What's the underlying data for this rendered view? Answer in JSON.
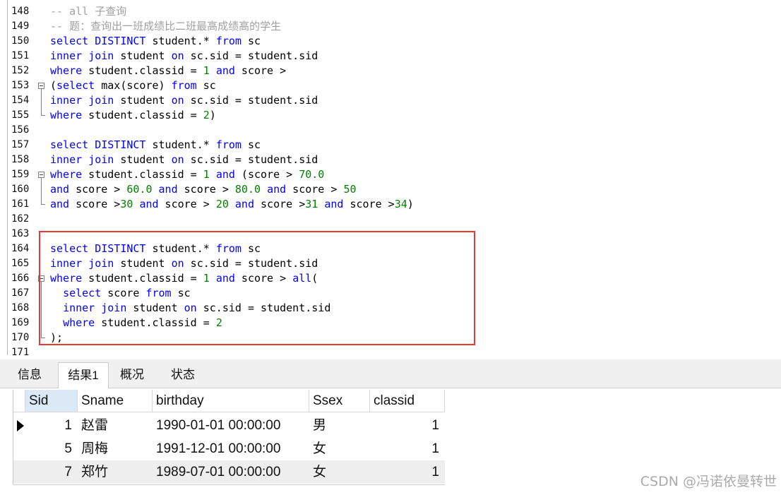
{
  "editor": {
    "lines": [
      {
        "num": "148",
        "tokens": [
          {
            "t": "-- all 子查询",
            "c": "cm"
          }
        ]
      },
      {
        "num": "149",
        "tokens": [
          {
            "t": "-- 题：查询出一班成绩比二班最高成绩高的学生",
            "c": "cm"
          }
        ]
      },
      {
        "num": "150",
        "tokens": [
          {
            "t": "select",
            "c": "kw"
          },
          {
            "t": " ",
            "c": "id"
          },
          {
            "t": "DISTINCT",
            "c": "kw"
          },
          {
            "t": " student.* ",
            "c": "id"
          },
          {
            "t": "from",
            "c": "kw"
          },
          {
            "t": " sc",
            "c": "id"
          }
        ]
      },
      {
        "num": "151",
        "tokens": [
          {
            "t": "inner",
            "c": "kw"
          },
          {
            "t": " ",
            "c": "id"
          },
          {
            "t": "join",
            "c": "kw"
          },
          {
            "t": " student ",
            "c": "id"
          },
          {
            "t": "on",
            "c": "kw"
          },
          {
            "t": " sc.sid = student.sid",
            "c": "id"
          }
        ]
      },
      {
        "num": "152",
        "tokens": [
          {
            "t": "where",
            "c": "kw"
          },
          {
            "t": " student.classid = ",
            "c": "id"
          },
          {
            "t": "1",
            "c": "num"
          },
          {
            "t": " ",
            "c": "id"
          },
          {
            "t": "and",
            "c": "kw"
          },
          {
            "t": " score >",
            "c": "id"
          }
        ]
      },
      {
        "num": "153",
        "tokens": [
          {
            "t": "(",
            "c": "id"
          },
          {
            "t": "select",
            "c": "kw"
          },
          {
            "t": " max(score) ",
            "c": "id"
          },
          {
            "t": "from",
            "c": "kw"
          },
          {
            "t": " sc",
            "c": "id"
          }
        ]
      },
      {
        "num": "154",
        "tokens": [
          {
            "t": "inner",
            "c": "kw"
          },
          {
            "t": " ",
            "c": "id"
          },
          {
            "t": "join",
            "c": "kw"
          },
          {
            "t": " student ",
            "c": "id"
          },
          {
            "t": "on",
            "c": "kw"
          },
          {
            "t": " sc.sid = student.sid",
            "c": "id"
          }
        ]
      },
      {
        "num": "155",
        "tokens": [
          {
            "t": "where",
            "c": "kw"
          },
          {
            "t": " student.classid = ",
            "c": "id"
          },
          {
            "t": "2",
            "c": "num"
          },
          {
            "t": ")",
            "c": "id"
          }
        ]
      },
      {
        "num": "156",
        "tokens": []
      },
      {
        "num": "157",
        "tokens": [
          {
            "t": "select",
            "c": "kw"
          },
          {
            "t": " ",
            "c": "id"
          },
          {
            "t": "DISTINCT",
            "c": "kw"
          },
          {
            "t": " student.* ",
            "c": "id"
          },
          {
            "t": "from",
            "c": "kw"
          },
          {
            "t": " sc",
            "c": "id"
          }
        ]
      },
      {
        "num": "158",
        "tokens": [
          {
            "t": "inner",
            "c": "kw"
          },
          {
            "t": " ",
            "c": "id"
          },
          {
            "t": "join",
            "c": "kw"
          },
          {
            "t": " student ",
            "c": "id"
          },
          {
            "t": "on",
            "c": "kw"
          },
          {
            "t": " sc.sid = student.sid",
            "c": "id"
          }
        ]
      },
      {
        "num": "159",
        "tokens": [
          {
            "t": "where",
            "c": "kw"
          },
          {
            "t": " student.classid = ",
            "c": "id"
          },
          {
            "t": "1",
            "c": "num"
          },
          {
            "t": " ",
            "c": "id"
          },
          {
            "t": "and",
            "c": "kw"
          },
          {
            "t": " (score > ",
            "c": "id"
          },
          {
            "t": "70.0",
            "c": "num"
          }
        ]
      },
      {
        "num": "160",
        "tokens": [
          {
            "t": "and",
            "c": "kw"
          },
          {
            "t": " score > ",
            "c": "id"
          },
          {
            "t": "60.0",
            "c": "num"
          },
          {
            "t": " ",
            "c": "id"
          },
          {
            "t": "and",
            "c": "kw"
          },
          {
            "t": " score > ",
            "c": "id"
          },
          {
            "t": "80.0",
            "c": "num"
          },
          {
            "t": " ",
            "c": "id"
          },
          {
            "t": "and",
            "c": "kw"
          },
          {
            "t": " score > ",
            "c": "id"
          },
          {
            "t": "50",
            "c": "num"
          }
        ]
      },
      {
        "num": "161",
        "tokens": [
          {
            "t": "and",
            "c": "kw"
          },
          {
            "t": " score >",
            "c": "id"
          },
          {
            "t": "30",
            "c": "num"
          },
          {
            "t": " ",
            "c": "id"
          },
          {
            "t": "and",
            "c": "kw"
          },
          {
            "t": " score > ",
            "c": "id"
          },
          {
            "t": "20",
            "c": "num"
          },
          {
            "t": " ",
            "c": "id"
          },
          {
            "t": "and",
            "c": "kw"
          },
          {
            "t": " score >",
            "c": "id"
          },
          {
            "t": "31",
            "c": "num"
          },
          {
            "t": " ",
            "c": "id"
          },
          {
            "t": "and",
            "c": "kw"
          },
          {
            "t": " score >",
            "c": "id"
          },
          {
            "t": "34",
            "c": "num"
          },
          {
            "t": ")",
            "c": "id"
          }
        ]
      },
      {
        "num": "162",
        "tokens": []
      },
      {
        "num": "163",
        "tokens": []
      },
      {
        "num": "164",
        "tokens": [
          {
            "t": "select",
            "c": "kw"
          },
          {
            "t": " ",
            "c": "id"
          },
          {
            "t": "DISTINCT",
            "c": "kw"
          },
          {
            "t": " student.* ",
            "c": "id"
          },
          {
            "t": "from",
            "c": "kw"
          },
          {
            "t": " sc",
            "c": "id"
          }
        ]
      },
      {
        "num": "165",
        "tokens": [
          {
            "t": "inner",
            "c": "kw"
          },
          {
            "t": " ",
            "c": "id"
          },
          {
            "t": "join",
            "c": "kw"
          },
          {
            "t": " student ",
            "c": "id"
          },
          {
            "t": "on",
            "c": "kw"
          },
          {
            "t": " sc.sid = student.sid",
            "c": "id"
          }
        ]
      },
      {
        "num": "166",
        "tokens": [
          {
            "t": "where",
            "c": "kw"
          },
          {
            "t": " student.classid = ",
            "c": "id"
          },
          {
            "t": "1",
            "c": "num"
          },
          {
            "t": " ",
            "c": "id"
          },
          {
            "t": "and",
            "c": "kw"
          },
          {
            "t": " score > ",
            "c": "id"
          },
          {
            "t": "all",
            "c": "kw"
          },
          {
            "t": "(",
            "c": "id"
          }
        ]
      },
      {
        "num": "167",
        "tokens": [
          {
            "t": "  ",
            "c": "id"
          },
          {
            "t": "select",
            "c": "kw"
          },
          {
            "t": " score ",
            "c": "id"
          },
          {
            "t": "from",
            "c": "kw"
          },
          {
            "t": " sc",
            "c": "id"
          }
        ]
      },
      {
        "num": "168",
        "tokens": [
          {
            "t": "  ",
            "c": "id"
          },
          {
            "t": "inner",
            "c": "kw"
          },
          {
            "t": " ",
            "c": "id"
          },
          {
            "t": "join",
            "c": "kw"
          },
          {
            "t": " student ",
            "c": "id"
          },
          {
            "t": "on",
            "c": "kw"
          },
          {
            "t": " sc.sid = student.sid",
            "c": "id"
          }
        ]
      },
      {
        "num": "169",
        "tokens": [
          {
            "t": "  ",
            "c": "id"
          },
          {
            "t": "where",
            "c": "kw"
          },
          {
            "t": " student.classid = ",
            "c": "id"
          },
          {
            "t": "2",
            "c": "num"
          }
        ]
      },
      {
        "num": "170",
        "tokens": [
          {
            "t": ");",
            "c": "id"
          }
        ]
      },
      {
        "num": "171",
        "tokens": []
      }
    ]
  },
  "tabs": [
    {
      "label": "信息",
      "active": false
    },
    {
      "label": "结果1",
      "active": true
    },
    {
      "label": "概况",
      "active": false
    },
    {
      "label": "状态",
      "active": false
    }
  ],
  "grid": {
    "columns": [
      "Sid",
      "Sname",
      "birthday",
      "Ssex",
      "classid"
    ],
    "rows": [
      {
        "Sid": "1",
        "Sname": "赵雷",
        "birthday": "1990-01-01 00:00:00",
        "Ssex": "男",
        "classid": "1"
      },
      {
        "Sid": "5",
        "Sname": "周梅",
        "birthday": "1991-12-01 00:00:00",
        "Ssex": "女",
        "classid": "1"
      },
      {
        "Sid": "7",
        "Sname": "郑竹",
        "birthday": "1989-07-01 00:00:00",
        "Ssex": "女",
        "classid": "1"
      }
    ]
  },
  "watermark": "CSDN @冯诺依曼转世",
  "colors": {
    "keyword": "#0000ff",
    "number": "#008000",
    "comment": "#a0a0a0",
    "highlight_border": "#e53935"
  }
}
